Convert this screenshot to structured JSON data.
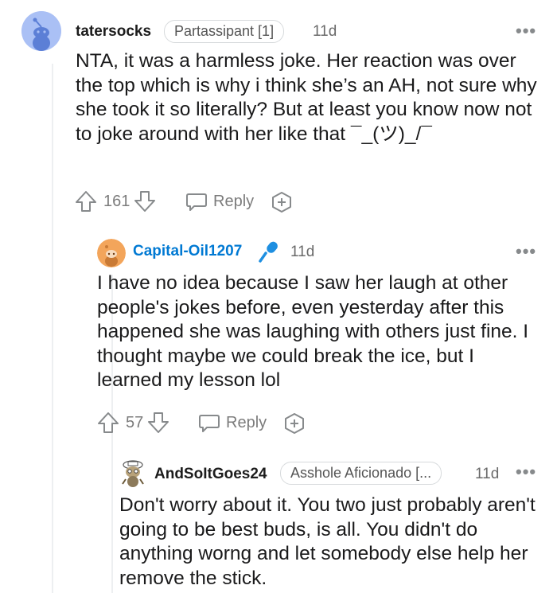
{
  "comments": [
    {
      "username": "tatersocks",
      "flair": "Partassipant [1]",
      "time": "11d",
      "more": "•••",
      "body": "NTA, it was a harmless joke. Her reaction was over the top which is why i think she’s an AH, not sure why she took it so literally? But at least you know now not to joke around with her like that ¯_(ツ)_/¯",
      "votes": "161",
      "reply_label": "Reply"
    },
    {
      "username": "Capital-Oil1207",
      "time": "11d",
      "more": "•••",
      "body": "I have no idea because I saw her laugh at other people's jokes before, even yesterday after this happened she was laughing with others just fine. I thought maybe we could break the ice, but I learned my lesson lol",
      "votes": "57",
      "reply_label": "Reply",
      "username_color": "#0079d3",
      "badge_icon": "microphone-icon"
    },
    {
      "username": "AndSoItGoes24",
      "flair": "Asshole Aficionado [...",
      "time": "11d",
      "more": "•••",
      "body": "Don't worry about it. You two just probably aren't going to be best buds, is all. You didn't do anything worng and let somebody else help her remove the stick."
    }
  ],
  "icons": {
    "upvote": "upvote-arrow-icon",
    "downvote": "downvote-arrow-icon",
    "reply": "speech-bubble-icon",
    "award": "add-award-icon"
  }
}
